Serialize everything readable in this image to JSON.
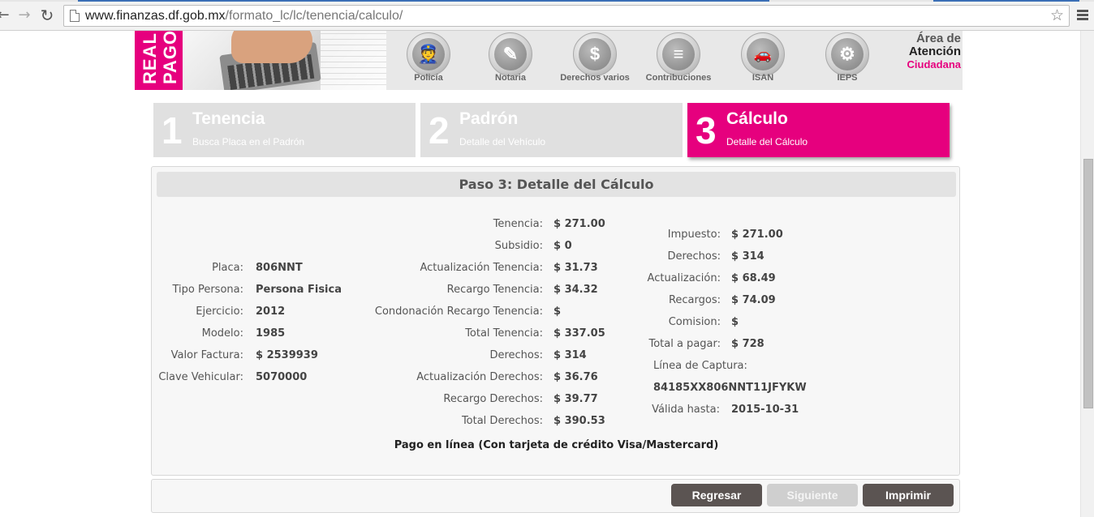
{
  "browser": {
    "url_host": "www.finanzas.df.gob.mx",
    "url_path": "/formato_lc/lc/tenencia/calculo/"
  },
  "banner": {
    "strip_text_1": "REAL",
    "strip_text_2": "PAGO",
    "services": [
      {
        "label": "Policía",
        "icon": "police-icon",
        "glyph": "👮"
      },
      {
        "label": "Notaria",
        "icon": "notary-icon",
        "glyph": "✎"
      },
      {
        "label": "Derechos varios",
        "icon": "dollar-icon",
        "glyph": "$"
      },
      {
        "label": "Contribuciones",
        "icon": "coins-icon",
        "glyph": "≡"
      },
      {
        "label": "ISAN",
        "icon": "new-car-icon",
        "glyph": "🚗"
      },
      {
        "label": "IEPS",
        "icon": "gear-icon",
        "glyph": "⚙"
      }
    ],
    "area_line1": "Área de",
    "area_line2": "Atención",
    "area_line3": "Ciudadana"
  },
  "steps": [
    {
      "num": "1",
      "title": "Tenencia",
      "sub": "Busca Placa en el Padrón"
    },
    {
      "num": "2",
      "title": "Padrón",
      "sub": "Detalle del Vehículo"
    },
    {
      "num": "3",
      "title": "Cálculo",
      "sub": "Detalle del Cálculo"
    }
  ],
  "panel": {
    "title": "Paso 3: Detalle del Cálculo",
    "vehicle": [
      {
        "k": "Placa:",
        "v": "806NNT"
      },
      {
        "k": "Tipo Persona:",
        "v": "Persona Fisica"
      },
      {
        "k": "Ejercicio:",
        "v": "2012"
      },
      {
        "k": "Modelo:",
        "v": "1985"
      },
      {
        "k": "Valor Factura:",
        "v": "$ 2539939"
      },
      {
        "k": "Clave Vehicular:",
        "v": "5070000"
      }
    ],
    "calc": [
      {
        "k": "Tenencia:",
        "v": "$ 271.00"
      },
      {
        "k": "Subsidio:",
        "v": "$ 0"
      },
      {
        "k": "Actualización Tenencia:",
        "v": "$ 31.73"
      },
      {
        "k": "Recargo Tenencia:",
        "v": "$ 34.32"
      },
      {
        "k": "Condonación Recargo Tenencia:",
        "v": "$"
      },
      {
        "k": "Total Tenencia:",
        "v": "$ 337.05"
      },
      {
        "k": "Derechos:",
        "v": "$ 314"
      },
      {
        "k": "Actualización Derechos:",
        "v": "$ 36.76"
      },
      {
        "k": "Recargo Derechos:",
        "v": "$ 39.77"
      },
      {
        "k": "Total Derechos:",
        "v": "$ 390.53"
      }
    ],
    "summary": [
      {
        "k": "Impuesto:",
        "v": "$ 271.00"
      },
      {
        "k": "Derechos:",
        "v": "$ 314"
      },
      {
        "k": "Actualización:",
        "v": "$ 68.49"
      },
      {
        "k": "Recargos:",
        "v": "$ 74.09"
      },
      {
        "k": "Comision:",
        "v": "$"
      },
      {
        "k": "Total a pagar:",
        "v": "$ 728"
      }
    ],
    "linea_label": "Línea de Captura:",
    "linea_value": "84185XX806NNT11JFYKW",
    "valida_label": "Válida hasta:",
    "valida_value": "2015-10-31",
    "pago_text": "Pago en línea (Con tarjeta de crédito Visa/Mastercard)"
  },
  "buttons": {
    "regresar": "Regresar",
    "siguiente": "Siguiente",
    "imprimir": "Imprimir"
  },
  "colors": {
    "accent": "#e6007e",
    "step_inactive": "#e0e0e0",
    "button_dark": "#5b5452"
  }
}
